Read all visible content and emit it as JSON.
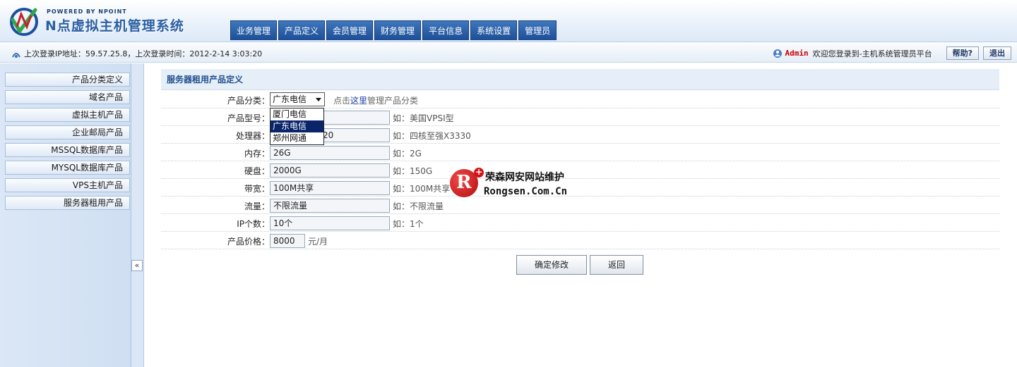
{
  "header": {
    "powered": "POWERED BY NPOINT",
    "brand": "N点虚拟主机管理系统",
    "nav": [
      "业务管理",
      "产品定义",
      "会员管理",
      "财务管理",
      "平台信息",
      "系统设置",
      "管理员"
    ]
  },
  "infobar": {
    "login_info": "上次登录IP地址：59.57.25.8，上次登录时间：2012-2-14 3:03:20",
    "admin": "Admin",
    "welcome": "欢迎您登录到-主机系统管理员平台",
    "help": "帮助?",
    "logout": "退出"
  },
  "sidebar": {
    "items": [
      "产品分类定义",
      "域名产品",
      "虚拟主机产品",
      "企业邮局产品",
      "MSSQL数据库产品",
      "MYSQL数据库产品",
      "VPS主机产品",
      "服务器租用产品"
    ],
    "collapse": "«"
  },
  "form": {
    "title": "服务器租用产品定义",
    "category": {
      "label": "产品分类：",
      "selected": "广东电信",
      "hint_prefix": "点击",
      "hint_link": "这里",
      "hint_suffix": "管理产品分类",
      "options": [
        "厦门电信",
        "广东电信",
        "郑州网通"
      ]
    },
    "model": {
      "label": "产品型号：",
      "value": "",
      "hint": "如：美国VPSⅠ型"
    },
    "cpu": {
      "label": "处理器：",
      "value": "20",
      "hint": "如：四核至强X3330"
    },
    "memory": {
      "label": "内存：",
      "value": "26G",
      "hint": "如：2G"
    },
    "disk": {
      "label": "硬盘：",
      "value": "2000G",
      "hint": "如：150G"
    },
    "bandwidth": {
      "label": "带宽：",
      "value": "100M共享",
      "hint": "如：100M共享"
    },
    "traffic": {
      "label": "流量：",
      "value": "不限流量",
      "hint": "如：不限流量"
    },
    "ip": {
      "label": "IP个数：",
      "value": "10个",
      "hint": "如：1个"
    },
    "price": {
      "label": "产品价格：",
      "value": "8000",
      "unit": "元/月"
    },
    "submit": "确定修改",
    "back": "返回"
  },
  "watermark": {
    "cn": "荣森网安网站维护",
    "en": "Rongsen.Com.Cn",
    "r": "R",
    "plus": "+"
  }
}
